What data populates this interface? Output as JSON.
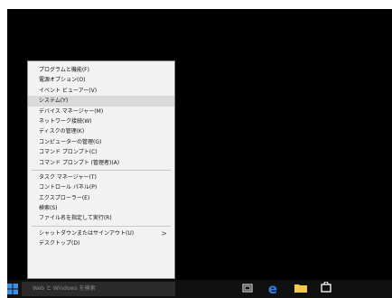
{
  "context_menu": {
    "items": [
      {
        "label": "プログラムと機能(F)"
      },
      {
        "label": "電源オプション(O)"
      },
      {
        "label": "イベント ビューアー(V)"
      },
      {
        "label": "システム(Y)",
        "selected": true
      },
      {
        "label": "デバイス マネージャー(M)"
      },
      {
        "label": "ネットワーク接続(W)"
      },
      {
        "label": "ディスクの管理(K)"
      },
      {
        "label": "コンピューターの管理(G)"
      },
      {
        "label": "コマンド プロンプト(C)"
      },
      {
        "label": "コマンド プロンプト (管理者)(A)"
      }
    ],
    "items2": [
      {
        "label": "タスク マネージャー(T)"
      },
      {
        "label": "コントロール パネル(P)"
      },
      {
        "label": "エクスプローラー(E)"
      },
      {
        "label": "検索(S)"
      },
      {
        "label": "ファイル名を指定して実行(R)"
      }
    ],
    "items3": [
      {
        "label": "シャットダウンまたはサインアウト(U)",
        "has_submenu": true,
        "arrow": ">"
      },
      {
        "label": "デスクトップ(D)"
      }
    ]
  },
  "taskbar": {
    "start_icon": "windows-logo-icon",
    "search_text": "Web と Windows を検索",
    "icons": [
      "task-view-icon",
      "edge-icon",
      "file-explorer-icon",
      "store-icon"
    ],
    "accent": "#3d8ee8"
  }
}
